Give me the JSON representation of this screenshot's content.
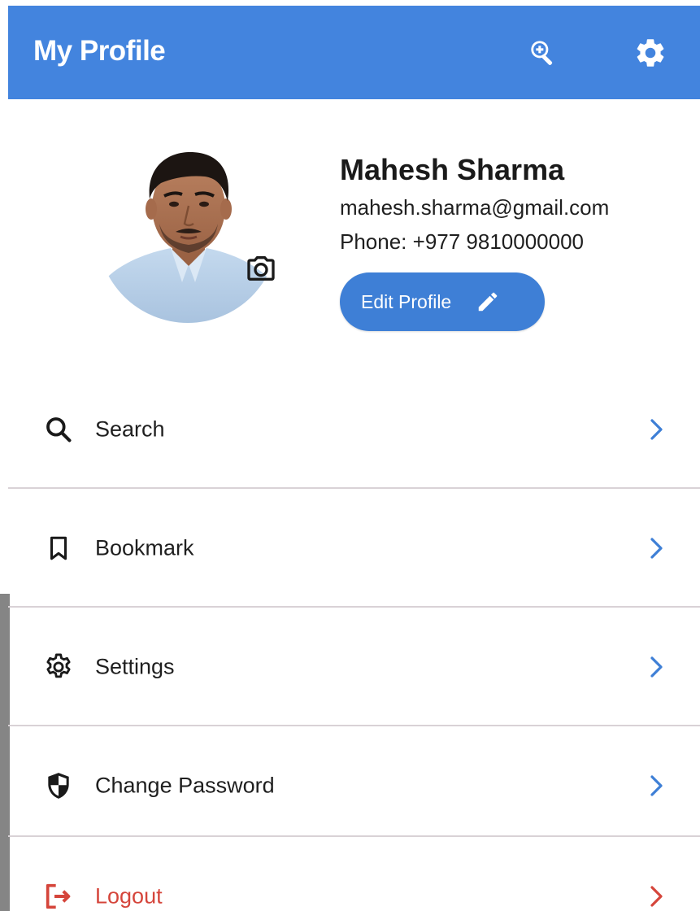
{
  "appbar": {
    "title": "My Profile",
    "background": "#4384de",
    "actions": [
      {
        "icon": "zoom-in-icon"
      },
      {
        "icon": "gear-icon"
      }
    ]
  },
  "profile": {
    "name": "Mahesh Sharma",
    "email": "mahesh.sharma@gmail.com",
    "phone": "Phone: +977 9810000000",
    "edit_label": "Edit Profile",
    "edit_icon": "pencil-icon",
    "camera_icon": "camera-icon",
    "accent": "#3e7fd6"
  },
  "menu": {
    "items": [
      {
        "label": "Search",
        "icon": "search-icon"
      },
      {
        "label": "Bookmark",
        "icon": "bookmark-icon"
      },
      {
        "label": "Settings",
        "icon": "settings-icon"
      },
      {
        "label": "Change Password",
        "icon": "shield-icon"
      },
      {
        "label": "Logout",
        "icon": "logout-icon"
      }
    ],
    "chevron_color": "#3e7fd6",
    "logout_color": "#d5453b",
    "divider_color": "#d9d2d6"
  }
}
